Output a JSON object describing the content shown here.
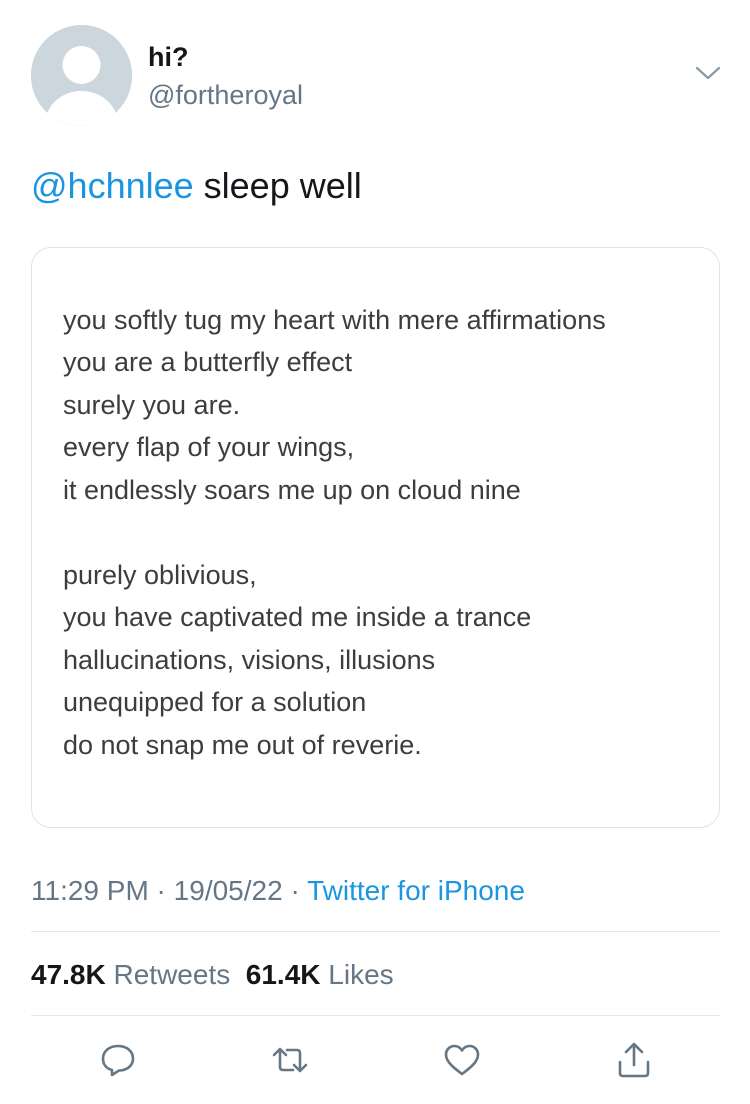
{
  "author": {
    "display_name": "hi?",
    "handle": "@fortheroyal",
    "avatar_icon": "default-profile-avatar-icon"
  },
  "tweet": {
    "mention": "@hchnlee",
    "text": " sleep well"
  },
  "image": {
    "poem_lines": [
      "you softly tug my heart with mere affirmations",
      "you are a butterfly effect",
      "surely you are.",
      "every flap of your wings,",
      "it endlessly soars me up on cloud nine",
      "purely oblivious,",
      "you have captivated me inside a trance",
      "hallucinations, visions, illusions",
      "unequipped for a solution",
      "do not snap me out of reverie."
    ]
  },
  "meta": {
    "time": "11:29 PM",
    "separator": " · ",
    "date": "19/05/22",
    "source": "Twitter for iPhone"
  },
  "stats": {
    "retweets_count": "47.8K",
    "retweets_label": "Retweets",
    "likes_count": "61.4K",
    "likes_label": "Likes"
  },
  "actions": {
    "reply_icon": "reply-icon",
    "retweet_icon": "retweet-icon",
    "like_icon": "heart-icon",
    "share_icon": "share-icon"
  },
  "colors": {
    "link": "#1b95e0",
    "secondary_text": "#657786",
    "divider": "#e1e8ed"
  }
}
